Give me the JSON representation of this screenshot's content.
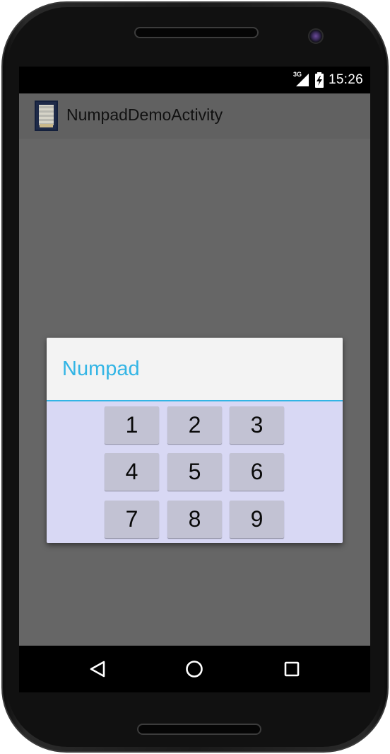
{
  "status_bar": {
    "network_label": "3G",
    "time": "15:26",
    "icons": [
      "signal-icon",
      "battery-charging-icon"
    ]
  },
  "action_bar": {
    "app_icon": "app-launcher-icon",
    "title": "NumpadDemoActivity"
  },
  "dialog": {
    "title": "Numpad",
    "accent_color": "#33b5e5",
    "keys": [
      {
        "label": "1"
      },
      {
        "label": "2"
      },
      {
        "label": "3"
      },
      {
        "label": "4"
      },
      {
        "label": "5"
      },
      {
        "label": "6"
      },
      {
        "label": "7"
      },
      {
        "label": "8"
      },
      {
        "label": "9"
      }
    ]
  },
  "nav_bar": {
    "buttons": [
      "back-icon",
      "home-icon",
      "recents-icon"
    ]
  }
}
